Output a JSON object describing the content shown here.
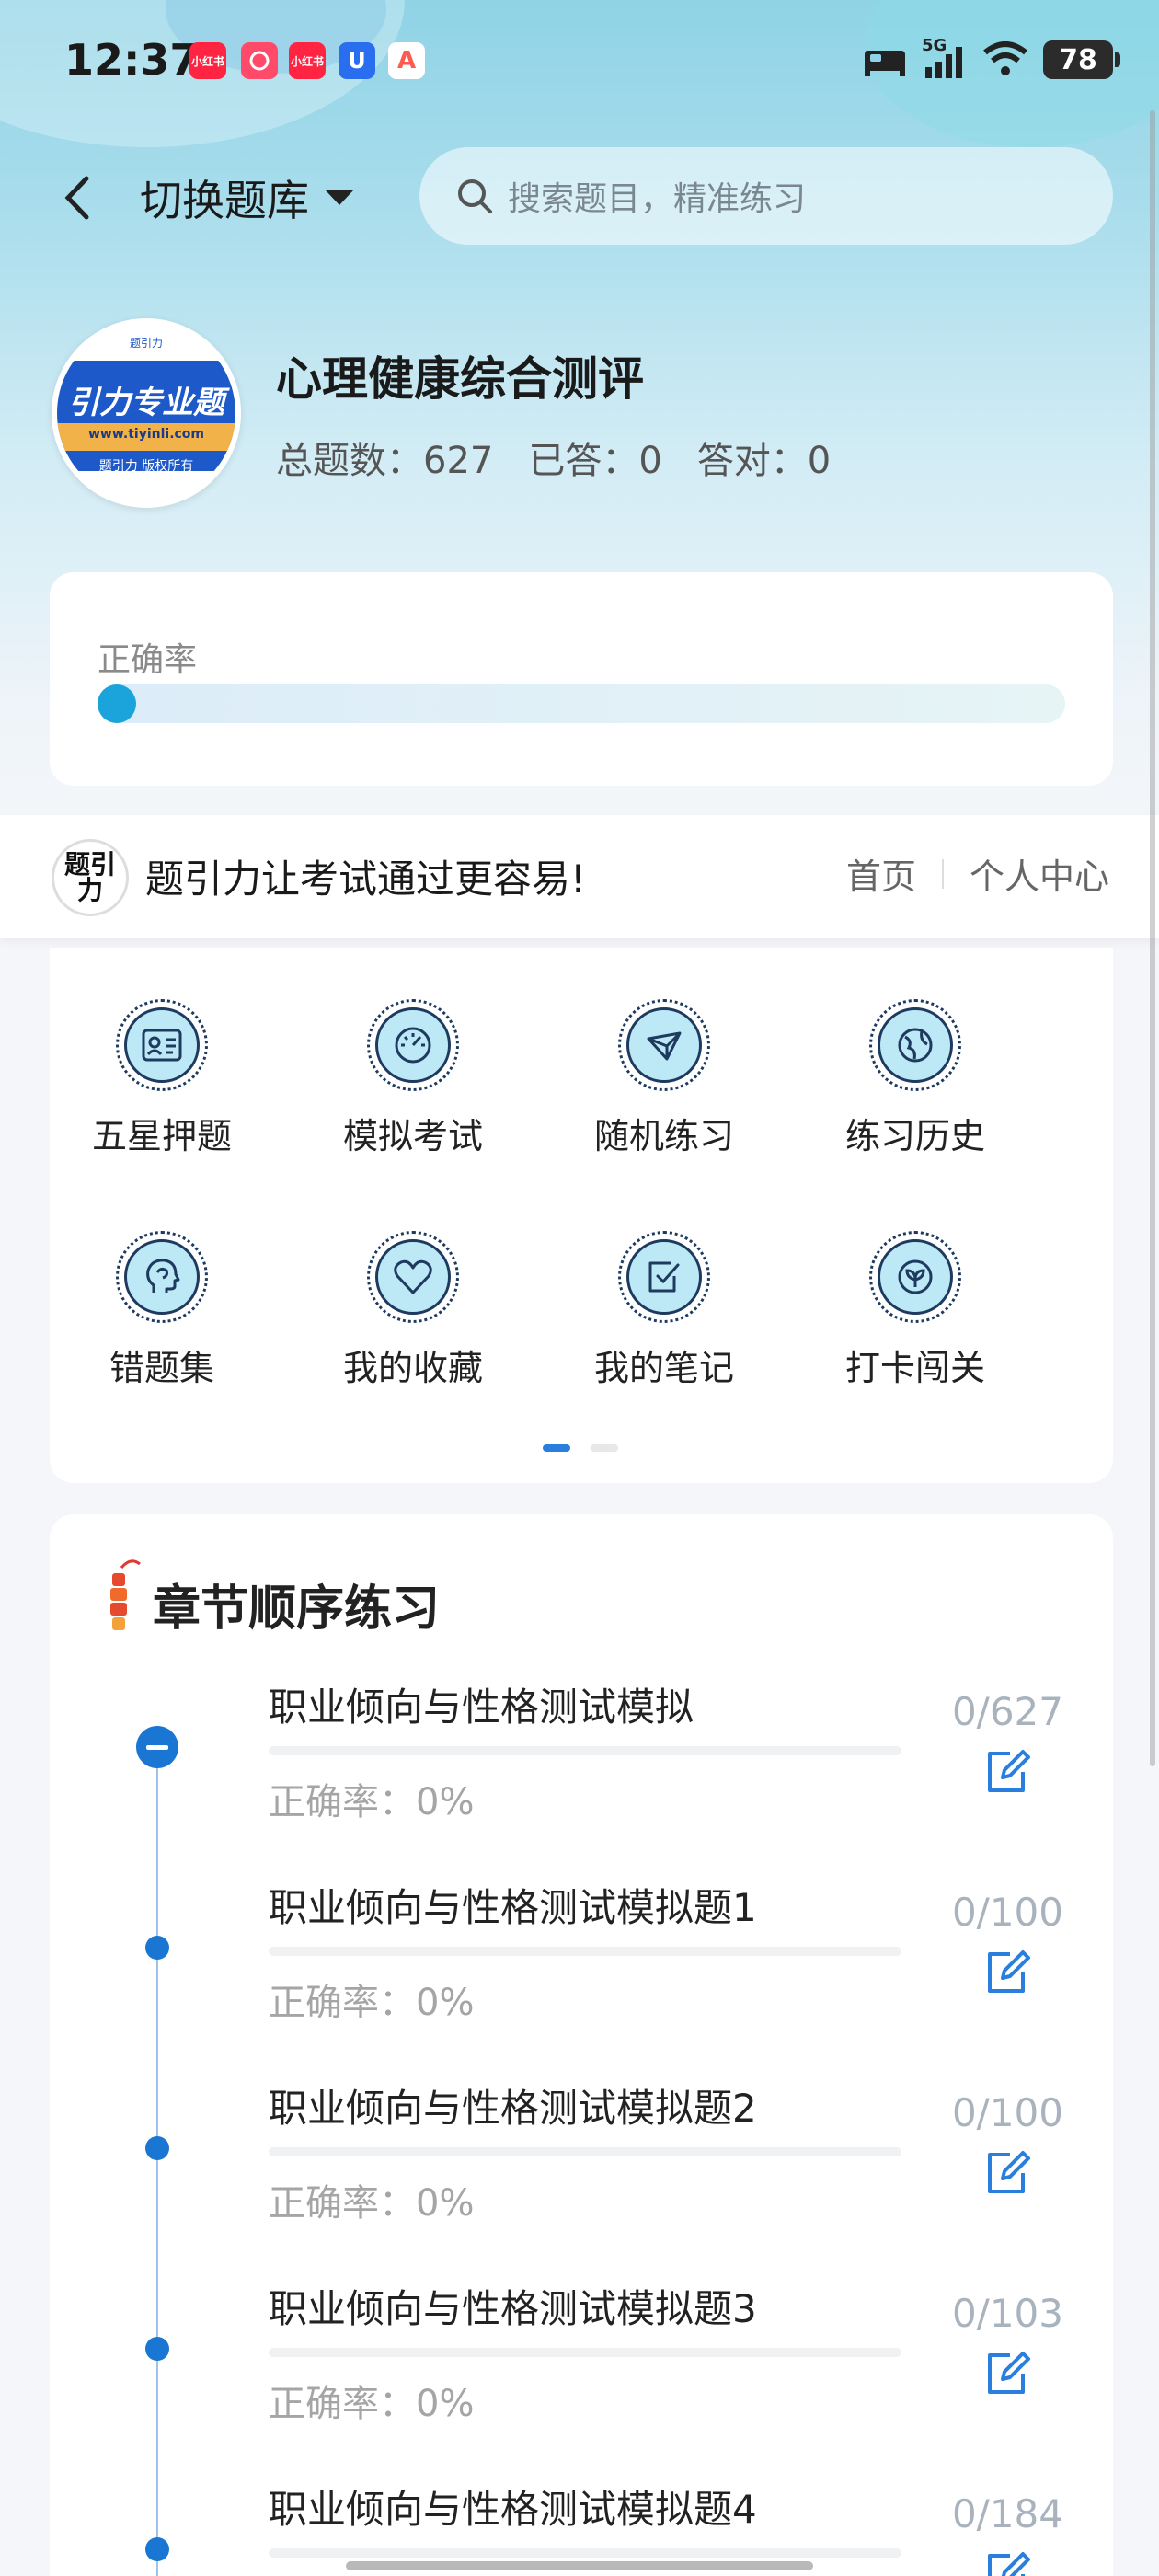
{
  "status_bar": {
    "time": "12:37",
    "apps": [
      {
        "icon": "xiaohongshu-icon",
        "text": "小红书",
        "color": "#ff2442"
      },
      {
        "icon": "weibo-like-icon",
        "text": "",
        "color": "#ff4a6a"
      },
      {
        "icon": "xiaohongshu-icon",
        "text": "小红书",
        "color": "#ff2442"
      },
      {
        "icon": "u-app-icon",
        "text": "U",
        "color": "#2a6ef0"
      },
      {
        "icon": "a-app-icon",
        "text": "A",
        "color": "#ff5a4e"
      }
    ],
    "network": "5G",
    "battery": "78"
  },
  "header": {
    "switch_label": "切换题库",
    "search_placeholder": "搜索题目，精准练习"
  },
  "bank": {
    "logo_brand": "引力专业题",
    "logo_url": "www.tiyinli.com",
    "logo_copyright": "题引力 版权所有",
    "logo_mini": "题引力",
    "title": "心理健康综合测评",
    "total_label": "总题数：627",
    "answered_label": "已答：0",
    "correct_label": "答对：0"
  },
  "accuracy": {
    "label": "正确率",
    "value": 0
  },
  "promo": {
    "logo_text": "题引力",
    "slogan": "题引力让考试通过更容易!",
    "nav_home": "首页",
    "nav_personal": "个人中心"
  },
  "menu": {
    "items": [
      {
        "label": "五星押题",
        "icon": "id-card-icon"
      },
      {
        "label": "模拟考试",
        "icon": "speedometer-icon"
      },
      {
        "label": "随机练习",
        "icon": "shuffle-icon"
      },
      {
        "label": "练习历史",
        "icon": "globe-icon"
      },
      {
        "label": "错题集",
        "icon": "head-icon"
      },
      {
        "label": "我的收藏",
        "icon": "heart-icon"
      },
      {
        "label": "我的笔记",
        "icon": "checklist-icon"
      },
      {
        "label": "打卡闯关",
        "icon": "leaf-icon"
      }
    ],
    "page_index": 0,
    "page_count": 2
  },
  "chapters": {
    "title": "章节顺序练习",
    "items": [
      {
        "name": "职业倾向与性格测试模拟",
        "accuracy": "正确率：0%",
        "count": "0/627",
        "expanded": true
      },
      {
        "name": "职业倾向与性格测试模拟题1",
        "accuracy": "正确率：0%",
        "count": "0/100"
      },
      {
        "name": "职业倾向与性格测试模拟题2",
        "accuracy": "正确率：0%",
        "count": "0/100"
      },
      {
        "name": "职业倾向与性格测试模拟题3",
        "accuracy": "正确率：0%",
        "count": "0/103"
      },
      {
        "name": "职业倾向与性格测试模拟题4",
        "accuracy": "",
        "count": "0/184"
      }
    ]
  },
  "colors": {
    "accent": "#1976d2",
    "accuracy_fill": "#1aa4db",
    "icon_fill": "#bde8f5",
    "icon_stroke": "#1e3a5f"
  }
}
